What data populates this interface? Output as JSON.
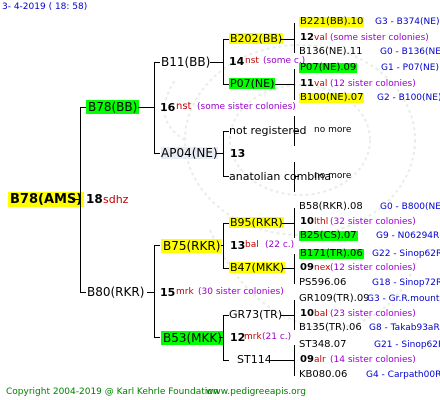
{
  "header": {
    "date": "3-  4-2019 ( 18: 58)"
  },
  "root": {
    "name": "B78(AMS)",
    "count": "18",
    "abbr": "sdhz"
  },
  "father": {
    "name": "B78(BB)",
    "count": "16",
    "abbr": "nst",
    "note": "(some sister colonies)"
  },
  "mother": {
    "name": "B80(RKR)",
    "count": "15",
    "abbr": "mrk",
    "note": "(30 sister colonies)"
  },
  "gen3": {
    "b11": {
      "name": "B11(BB)"
    },
    "ap04": {
      "name": "AP04(NE)",
      "count": "13"
    },
    "b75": {
      "name": "B75(RKR)",
      "count": "13",
      "abbr": "bal",
      "note": "(22 c.)"
    },
    "b53": {
      "name": "B53(MKK)",
      "count": "12",
      "abbr": "mrk",
      "note": "(21 c.)"
    }
  },
  "gen4": {
    "b202": {
      "name": "B202(BB)",
      "count": "14",
      "abbr": "nst",
      "note": "(some c.)"
    },
    "p07": {
      "name": "P07(NE)"
    },
    "notreg": {
      "name": "not registered"
    },
    "anatolian": {
      "name": "anatolian combina"
    },
    "b95": {
      "name": "B95(RKR)"
    },
    "b47": {
      "name": "B47(MKK)"
    },
    "gr73": {
      "name": "GR73(TR)"
    },
    "st114": {
      "name": "ST114"
    }
  },
  "gen5": {
    "b221": {
      "name": "B221(BB).10",
      "code": "G3 - B374(NE)"
    },
    "v12": {
      "count": "12",
      "abbr": "val",
      "note": "(some sister colonies)"
    },
    "b136": {
      "name": "B136(NE).11",
      "code": "G0 - B136(NE)"
    },
    "p07": {
      "name": "P07(NE).09",
      "code": "G1 - P07(NE)"
    },
    "v11": {
      "count": "11",
      "abbr": "val",
      "note": "(12 sister colonies)"
    },
    "b100": {
      "name": "B100(NE).07",
      "code": "G2 - B100(NE)"
    },
    "nomore1": {
      "name": "no more"
    },
    "nomore2": {
      "name": "no more"
    },
    "b58": {
      "name": "B58(RKR).08",
      "code": "G0 - B800(NE)"
    },
    "v10a": {
      "count": "10",
      "abbr": "lthl",
      "note": "(32 sister colonies)"
    },
    "b25": {
      "name": "B25(CS).07",
      "code": "G9 - N06294R"
    },
    "b171": {
      "name": "B171(TR).06",
      "code": "G22 - Sinop62R"
    },
    "v09a": {
      "count": "09",
      "abbr": "nex",
      "note": "(12 sister colonies)"
    },
    "ps596": {
      "name": "PS596.06",
      "code": "G18 - Sinop72R"
    },
    "gr109": {
      "name": "GR109(TR).09",
      "code": "G3 - Gr.R.mounta"
    },
    "v10b": {
      "count": "10",
      "abbr": "bal",
      "note": "(23 sister colonies)"
    },
    "b135": {
      "name": "B135(TR).06",
      "code": "G8 - Takab93aR"
    },
    "st348": {
      "name": "ST348.07",
      "code": "G21 - Sinop62R"
    },
    "v09b": {
      "count": "09",
      "abbr": "alr",
      "note": "(14 sister colonies)"
    },
    "kb080": {
      "name": "KB080.06",
      "code": "G4 - Carpath00R"
    }
  },
  "footer": {
    "copyright": "Copyright 2004-2019 @ Karl Kehrle Foundation",
    "site": "www.pedigreeapis.org"
  },
  "colors": {
    "highlight_yellow": "#ffff00",
    "highlight_green": "#00ff00",
    "abbr_red": "#c00000",
    "note_purple": "#9900cc",
    "code_blue": "#0000cc",
    "footer_green": "#008000"
  }
}
